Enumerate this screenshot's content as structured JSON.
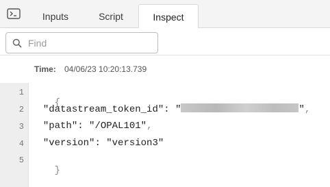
{
  "tabs": {
    "inputs": "Inputs",
    "script": "Script",
    "inspect": "Inspect",
    "active": "Inspect"
  },
  "find": {
    "placeholder": "Find",
    "value": ""
  },
  "time": {
    "label": "Time:",
    "value": "04/06/23 10:20:13.739"
  },
  "code": {
    "line_numbers": [
      "1",
      "2",
      "3",
      "4",
      "5"
    ],
    "open_brace": "{",
    "close_brace": "}",
    "fields": [
      {
        "key": "\"datastream_token_id\"",
        "value": "\"",
        "value_end": "\"",
        "redacted": true
      },
      {
        "key": "\"path\"",
        "value": "\"/OPAL101\""
      },
      {
        "key": "\"version\"",
        "value": "\"version3\""
      }
    ],
    "colon": ": ",
    "comma": ","
  },
  "icons": {
    "terminal": "terminal-icon",
    "search": "search-icon"
  }
}
